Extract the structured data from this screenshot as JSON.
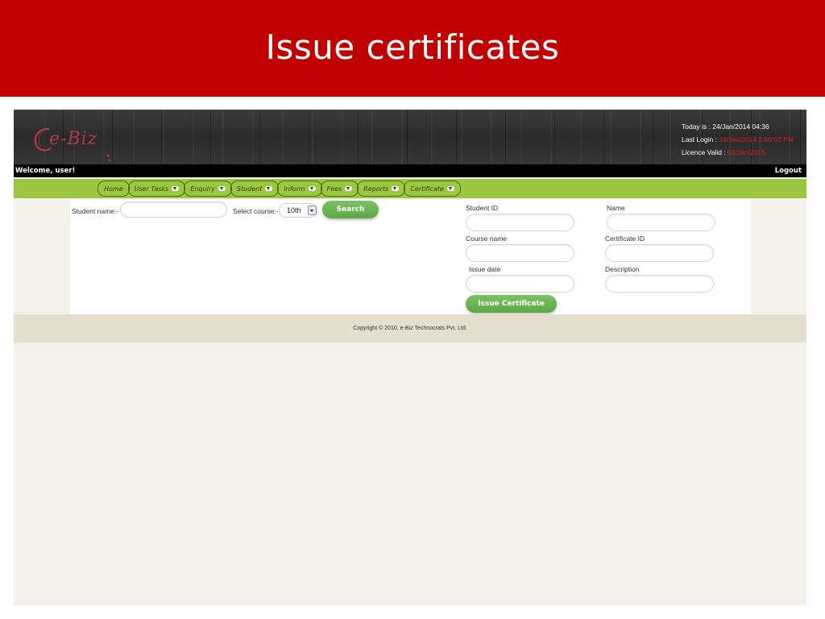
{
  "slide": {
    "title": "Issue certificates"
  },
  "header": {
    "logo_text": "e-Biz",
    "today_label": "Today is : 24/Jan/2014 04:36",
    "last_login_label": "Last Login : ",
    "last_login_value": "24/Jan/2014 2:50:02 PM",
    "licence_label": "Licence Valid : ",
    "licence_value": "01/Jan/2015"
  },
  "welcome_bar": {
    "welcome": "Welcome,  user!",
    "logout": "Logout"
  },
  "nav": {
    "items": [
      {
        "label": "Home",
        "has_dropdown": false
      },
      {
        "label": "User Tasks",
        "has_dropdown": true
      },
      {
        "label": "Enquiry",
        "has_dropdown": true
      },
      {
        "label": "Student",
        "has_dropdown": true
      },
      {
        "label": "Inform",
        "has_dropdown": true
      },
      {
        "label": "Fees",
        "has_dropdown": true
      },
      {
        "label": "Reports",
        "has_dropdown": true
      },
      {
        "label": "Certificate",
        "has_dropdown": true
      }
    ]
  },
  "search": {
    "student_name_label": "Student name:-",
    "student_name_value": "",
    "course_label": "Select course:-",
    "course_selected": "10th",
    "search_button": "Search"
  },
  "issue_form": {
    "student_id_label": "Student ID",
    "student_id_value": "",
    "name_label": "Name",
    "name_value": "",
    "course_name_label": "Course name",
    "course_name_value": "",
    "certificate_id_label": "Certificate ID",
    "certificate_id_value": "",
    "issue_date_label": "Issue date",
    "issue_date_value": "",
    "description_label": "Description",
    "description_value": "",
    "issue_button": "Issue Certificate"
  },
  "footer": {
    "copyright": "Copyright © 2010, e-Biz Technocrats Pvt. Ltd."
  },
  "colors": {
    "slide_header": "#c00000",
    "nav_bar": "#9bc840",
    "button_green": "#6ab552",
    "highlight_red": "#e01c1c",
    "footer_band": "#e4dfcf",
    "page_bg": "#f2f1ea"
  }
}
